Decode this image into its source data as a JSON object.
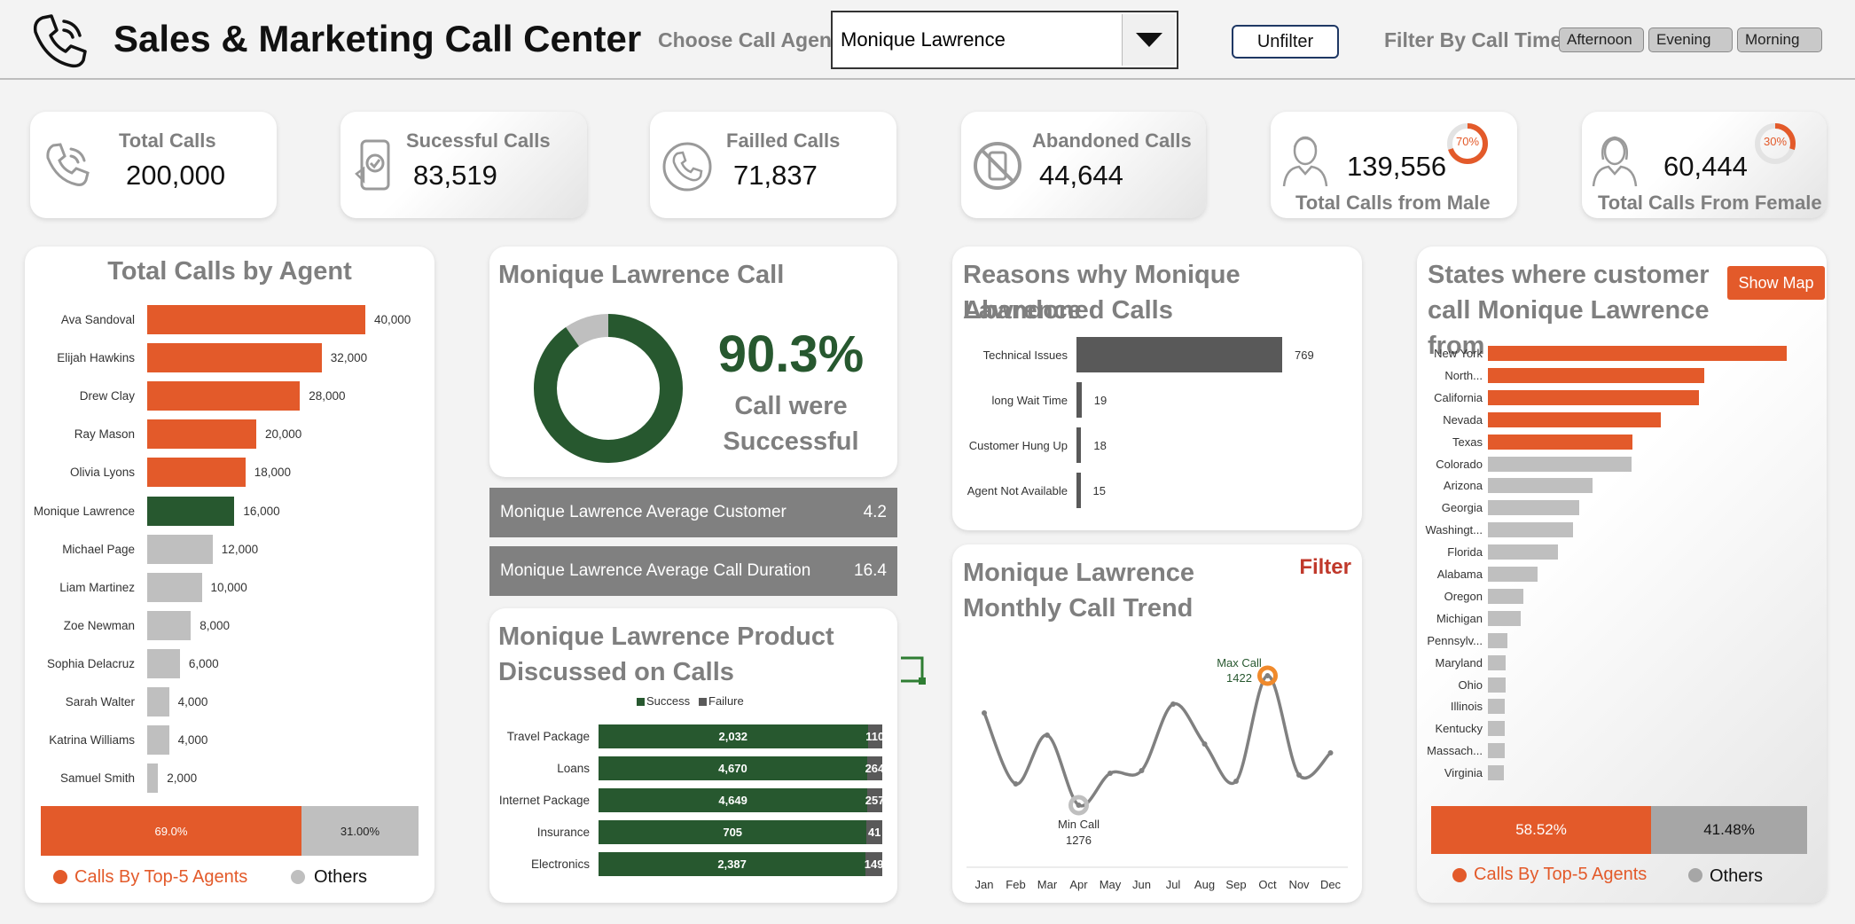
{
  "header": {
    "title": "Sales & Marketing Call Center",
    "agent_label": "Choose Call Agent:",
    "agent_selected": "Monique Lawrence",
    "unfilter_label": "Unfilter",
    "filter_time_label": "Filter By Call Time:",
    "time_slicers": [
      "Afternoon",
      "Evening",
      "Morning"
    ]
  },
  "kpis": {
    "total_calls": {
      "title": "Total Calls",
      "value": "200,000"
    },
    "successful_calls": {
      "title": "Sucessful  Calls",
      "value": "83,519"
    },
    "failed_calls": {
      "title": "Failled  Calls",
      "value": "71,837"
    },
    "abandoned_calls": {
      "title": "Abandoned  Calls",
      "value": "44,644"
    },
    "male_calls": {
      "title": "Total Calls from Male",
      "value": "139,556",
      "pct": "70%",
      "pct_value": 70
    },
    "female_calls": {
      "title": "Total Calls From Female",
      "value": "60,444",
      "pct": "30%",
      "pct_value": 30
    }
  },
  "colors": {
    "orange": "#e35a2a",
    "green": "#27582f",
    "grey": "#bfbfbf",
    "dark_grey": "#595959",
    "mid_grey": "#808080"
  },
  "agent_panel": {
    "title": "Total Calls by Agent",
    "top5_label": "Calls By Top-5 Agents",
    "others_label": "Others",
    "split": {
      "top5": "69.0%",
      "others": "31.00%",
      "top5_value": 69.0
    }
  },
  "success_panel": {
    "title": "Monique Lawrence Call",
    "pct": "90.3%",
    "caption_line1": "Call were",
    "caption_line2": "Successful",
    "avg_customer_label": "Monique Lawrence Average Customer",
    "avg_customer_value": "4.2",
    "avg_duration_label": "Monique Lawrence Average Call Duration",
    "avg_duration_value": "16.4"
  },
  "product_panel": {
    "title_line1": "Monique Lawrence  Product",
    "title_line2": "Discussed on Calls",
    "legend_success": "Success",
    "legend_failure": "Failure"
  },
  "reasons_panel": {
    "title_line1": "Reasons why Monique Lawrence",
    "title_line2": "Abandoned Calls"
  },
  "trend_panel": {
    "title_line1": "Monique Lawrence",
    "title_line2": "Monthly Call Trend",
    "filter_label": "Filter",
    "max_label": "Max Call",
    "max_value": "1422",
    "min_label": "Min Call",
    "min_value": "1276"
  },
  "states_panel": {
    "title_line1": "States where customer",
    "title_line2": "call Monique Lawrence",
    "title_line3": "from",
    "show_map_label": "Show Map",
    "top5_label": "Calls By Top-5 Agents",
    "others_label": "Others",
    "split": {
      "top5": "58.52%",
      "others": "41.48%",
      "top5_value": 58.52
    }
  },
  "chart_data": [
    {
      "id": "agents",
      "type": "bar",
      "orientation": "horizontal",
      "title": "Total Calls by Agent",
      "categories": [
        "Ava Sandoval",
        "Elijah Hawkins",
        "Drew Clay",
        "Ray Mason",
        "Olivia Lyons",
        "Monique Lawrence",
        "Michael Page",
        "Liam Martinez",
        "Zoe Newman",
        "Sophia Delacruz",
        "Sarah Walter",
        "Katrina Williams",
        "Samuel Smith"
      ],
      "values": [
        40000,
        32000,
        28000,
        20000,
        18000,
        16000,
        12000,
        10000,
        8000,
        6000,
        4000,
        4000,
        2000
      ],
      "value_labels": [
        "40,000",
        "32,000",
        "28,000",
        "20,000",
        "18,000",
        "16,000",
        "12,000",
        "10,000",
        "8,000",
        "6,000",
        "4,000",
        "4,000",
        "2,000"
      ],
      "xlim": [
        0,
        40000
      ]
    },
    {
      "id": "success_donut",
      "type": "pie",
      "title": "Monique Lawrence Call",
      "values": [
        90.3,
        9.7
      ]
    },
    {
      "id": "products",
      "type": "bar",
      "orientation": "horizontal",
      "stacked": "percent",
      "categories": [
        "Travel Package",
        "Loans",
        "Internet Package",
        "Insurance",
        "Electronics"
      ],
      "series": [
        {
          "name": "Success",
          "values": [
            2032,
            4670,
            4649,
            705,
            2387
          ],
          "labels": [
            "2,032",
            "4,670",
            "4,649",
            "705",
            "2,387"
          ]
        },
        {
          "name": "Failure",
          "values": [
            110,
            264,
            257,
            41,
            149
          ],
          "labels": [
            "110",
            "264",
            "257",
            "41",
            "149"
          ]
        }
      ]
    },
    {
      "id": "reasons",
      "type": "bar",
      "orientation": "horizontal",
      "categories": [
        "Technical Issues",
        "long Wait Time",
        "Customer Hung Up",
        "Agent Not Available"
      ],
      "values": [
        769,
        19,
        18,
        15
      ],
      "xlim": [
        0,
        769
      ]
    },
    {
      "id": "trend",
      "type": "line",
      "x": [
        "Jan",
        "Feb",
        "Mar",
        "Apr",
        "May",
        "Jun",
        "Jul",
        "Aug",
        "Sep",
        "Oct",
        "Nov",
        "Dec"
      ],
      "y": [
        1380,
        1300,
        1355,
        1276,
        1312,
        1315,
        1390,
        1345,
        1303,
        1422,
        1310,
        1335
      ],
      "ylim": [
        1230,
        1470
      ],
      "grid": false
    },
    {
      "id": "states",
      "type": "bar",
      "orientation": "horizontal",
      "categories": [
        "New York",
        "North...",
        "California",
        "Nevada",
        "Texas",
        "Colorado",
        "Arizona",
        "Georgia",
        "Washingt...",
        "Florida",
        "Alabama",
        "Oregon",
        "Michigan",
        "Pennsylv...",
        "Maryland",
        "Ohio",
        "Illinois",
        "Kentucky",
        "Massach...",
        "Virginia"
      ],
      "values": [
        1000,
        725,
        705,
        580,
        485,
        480,
        350,
        305,
        285,
        235,
        165,
        120,
        110,
        65,
        60,
        58,
        57,
        56,
        55,
        52
      ],
      "xlim": [
        0,
        1000
      ]
    }
  ]
}
